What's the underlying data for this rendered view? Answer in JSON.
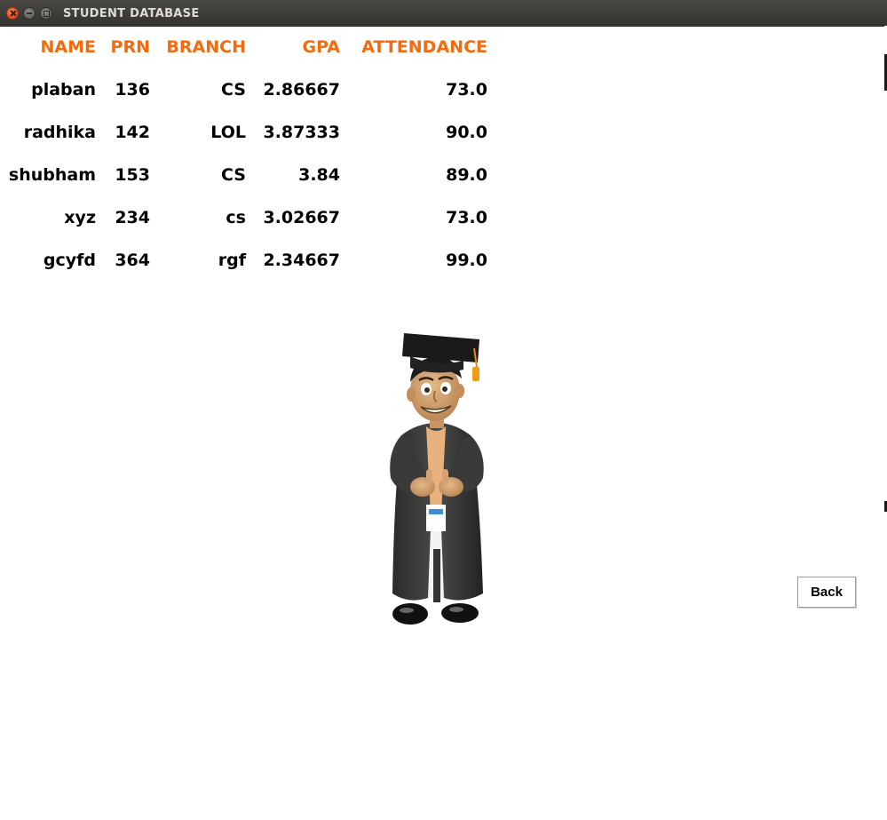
{
  "window": {
    "title": "STUDENT DATABASE",
    "controls": [
      "close",
      "minimize",
      "maximize"
    ]
  },
  "table": {
    "headers": [
      "NAME",
      "PRN",
      "BRANCH",
      "GPA",
      "ATTENDANCE"
    ],
    "rows": [
      [
        "plaban",
        "136",
        "CS",
        "2.86667",
        "73.0"
      ],
      [
        "radhika",
        "142",
        "LOL",
        "3.87333",
        "90.0"
      ],
      [
        "shubham",
        "153",
        "CS",
        "3.84",
        "89.0"
      ],
      [
        "xyz",
        "234",
        "cs",
        "3.02667",
        "73.0"
      ],
      [
        "gcyfd",
        "364",
        "rgf",
        "2.34667",
        "99.0"
      ]
    ]
  },
  "illustration": {
    "icon": "graduate-student-figure"
  },
  "buttons": {
    "back_label": "Back"
  },
  "colors": {
    "header": "#f26b0f",
    "titlebar": "#3c3b37"
  }
}
